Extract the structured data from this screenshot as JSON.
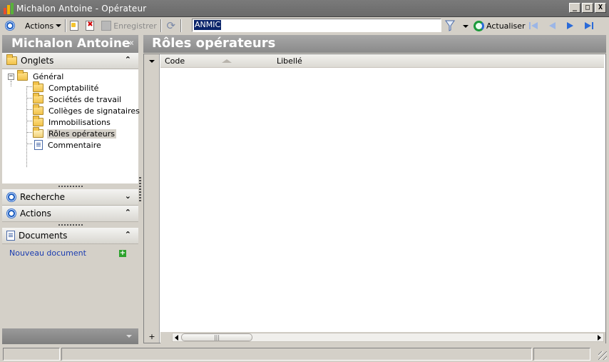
{
  "window": {
    "title": "Michalon Antoine - Opérateur",
    "controls": {
      "minimize": "_",
      "maximize": "□",
      "close": "X"
    }
  },
  "toolbar": {
    "actions_label": "Actions",
    "save_label": "Enregistrer",
    "search_value": "ANMIC",
    "refresh_label": "Actualiser",
    "icons": [
      "ring-icon",
      "new-document-icon",
      "delete-icon",
      "save-icon",
      "sync-icon",
      "filter-icon",
      "refresh-icon",
      "first-icon",
      "previous-icon",
      "next-icon",
      "last-icon"
    ]
  },
  "left_panel": {
    "user_name": "Michalon Antoine",
    "collapse_glyph": "«",
    "onglets": {
      "title": "Onglets",
      "chevron": "⌃",
      "tree": {
        "root": "Général",
        "expander": "−",
        "children": [
          {
            "label": "Comptabilité",
            "icon": "folder-icon"
          },
          {
            "label": "Sociétés de travail",
            "icon": "folder-icon"
          },
          {
            "label": "Collèges de signataires",
            "icon": "folder-icon"
          },
          {
            "label": "Immobilisations",
            "icon": "folder-icon"
          },
          {
            "label": "Rôles opérateurs",
            "icon": "open-folder-icon",
            "selected": true
          },
          {
            "label": "Commentaire",
            "icon": "page-icon"
          }
        ]
      }
    },
    "recherche": {
      "title": "Recherche",
      "chevron": "⌄"
    },
    "actions": {
      "title": "Actions",
      "chevron": "⌃"
    },
    "documents": {
      "title": "Documents",
      "chevron": "⌃",
      "new_document": "Nouveau document"
    }
  },
  "main": {
    "title": "Rôles opérateurs",
    "grid": {
      "columns": [
        "Code",
        "Libellé"
      ],
      "sorted_column": "Code",
      "rows": [],
      "add_row_glyph": "+",
      "scroll_thumb_grip": "|||"
    }
  },
  "colors": {
    "chrome": "#d4d0c8",
    "header_gray": "#8a8a8a",
    "selection": "#0a246a",
    "link": "#1a3cb0"
  }
}
